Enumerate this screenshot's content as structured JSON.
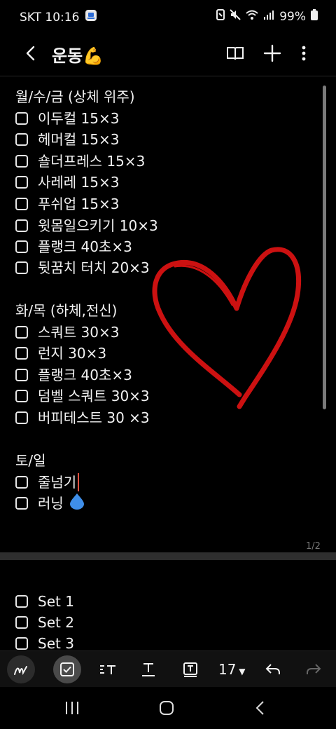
{
  "status": {
    "carrier_time": "SKT 10:16",
    "battery": "99%"
  },
  "note": {
    "title": "운동💪"
  },
  "section1": {
    "heading": "월/수/금 (상체 위주)",
    "items": [
      "이두컬 15×3",
      "헤머컬 15×3",
      "숄더프레스 15×3",
      "사레레 15×3",
      "푸쉬업 15×3",
      "윗몸일으키기 10×3",
      "플랭크 40초×3",
      "뒷꿈치 터치 20×3"
    ]
  },
  "section2": {
    "heading": "화/목 (하체,전신)",
    "items": [
      "스쿼트 30×3",
      "런지 30×3",
      "플랭크 40초×3",
      "덤벨 스쿼트 30×3",
      "버피테스트 30 ×3"
    ]
  },
  "section3": {
    "heading": "토/일",
    "items": [
      "줄넘기",
      "러닝"
    ]
  },
  "page_indicator": "1/2",
  "page2": {
    "items": [
      "Set 1",
      "Set 2",
      "Set 3"
    ]
  },
  "toolbar": {
    "font_size": "17"
  },
  "drawing": {
    "shape": "heart",
    "color": "#cc1111"
  },
  "icons": {
    "status": [
      "gallery-app-icon",
      "nfc-icon",
      "mute-icon",
      "wifi-icon",
      "signal-icon",
      "battery-icon"
    ],
    "appbar": [
      "back-icon",
      "book-icon",
      "plus-icon",
      "more-icon"
    ],
    "toolbar": [
      "pen-icon",
      "checkbox-icon",
      "text-style-icon",
      "underline-text-icon",
      "text-box-icon",
      "undo-icon",
      "redo-icon"
    ],
    "nav": [
      "recents-icon",
      "home-icon",
      "back-nav-icon"
    ]
  }
}
